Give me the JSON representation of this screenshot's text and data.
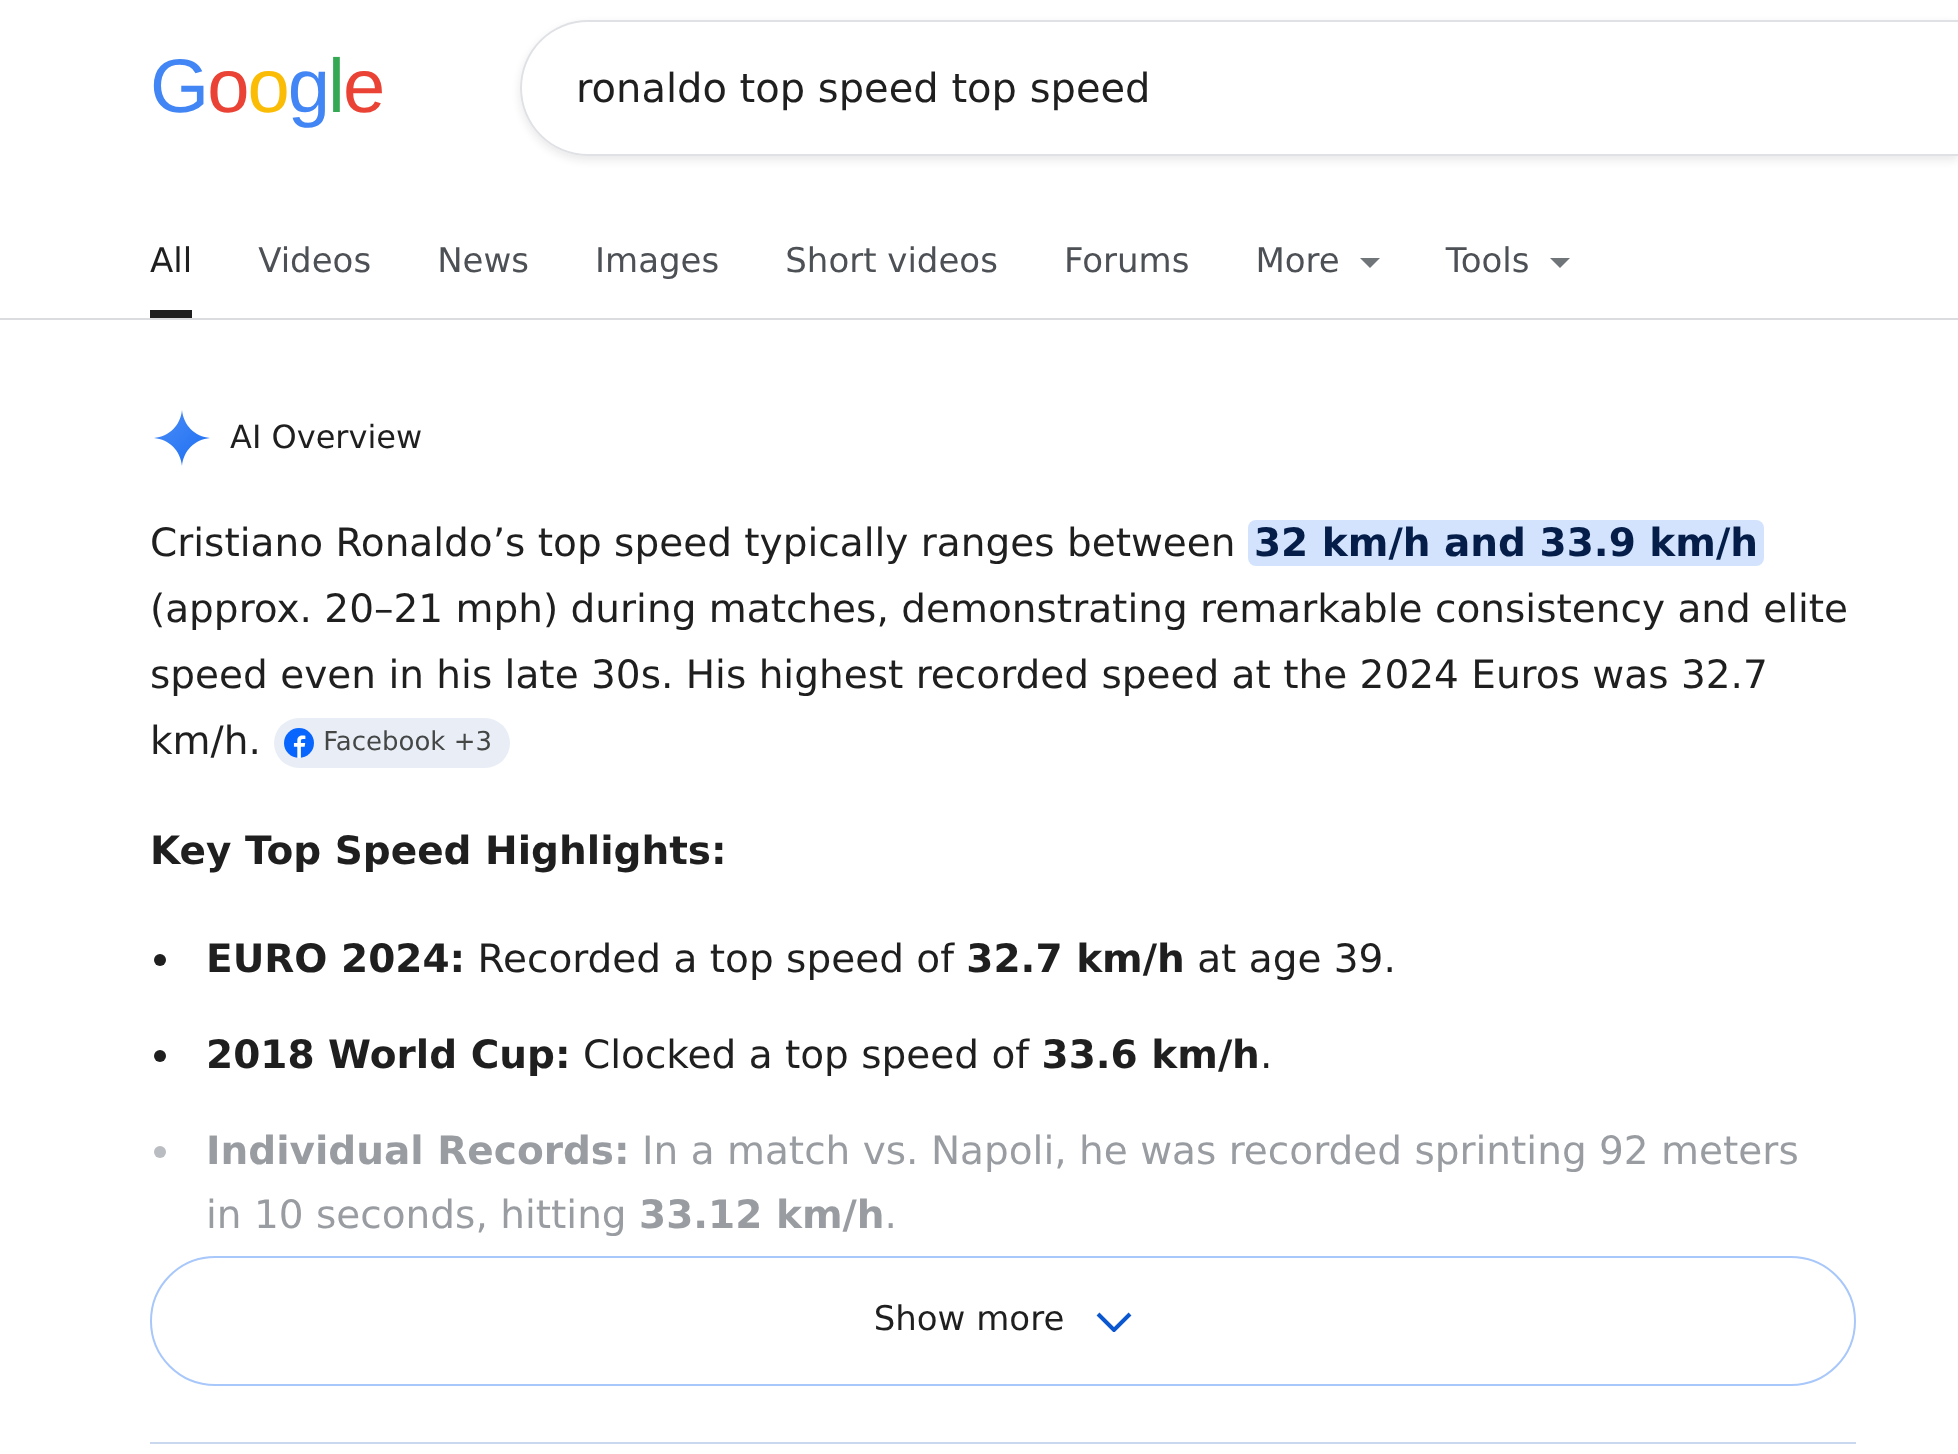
{
  "logo": {
    "text": "Google"
  },
  "search": {
    "value": "ronaldo top speed top speed"
  },
  "tabs": [
    {
      "label": "All",
      "selected": true,
      "kind": "plain"
    },
    {
      "label": "Videos",
      "selected": false,
      "kind": "plain"
    },
    {
      "label": "News",
      "selected": false,
      "kind": "plain"
    },
    {
      "label": "Images",
      "selected": false,
      "kind": "plain"
    },
    {
      "label": "Short videos",
      "selected": false,
      "kind": "plain"
    },
    {
      "label": "Forums",
      "selected": false,
      "kind": "plain"
    },
    {
      "label": "More",
      "selected": false,
      "kind": "dropdown"
    },
    {
      "label": "Tools",
      "selected": false,
      "kind": "dropdown"
    }
  ],
  "ai_overview": {
    "title": "AI Overview",
    "summary": "Cristiano Ronaldo’s top speed typically ranges between **32 km/h and 33.9 km/h** (approx. 20–21 mph) during matches, demonstrating remarkable consistency and elite speed even in his late 30s. His highest recorded speed at the 2024 Euros was 32.7 km/h.",
    "source_chip": "Facebook +3",
    "heading": "Key Top Speed Highlights:",
    "highlights": [
      {
        "text": "**EURO 2024:** Recorded a top speed of **32.7 km/h** at age 39.",
        "faded": false
      },
      {
        "text": "**2018 World Cup:** Clocked a top speed of **33.6 km/h**.",
        "faded": false
      },
      {
        "text": "**Individual Records:** In a match vs. Napoli, he was recorded sprinting 92 meters in 10 seconds, hitting **33.12 km/h**.",
        "faded": true
      }
    ],
    "show_more": "Show more"
  }
}
